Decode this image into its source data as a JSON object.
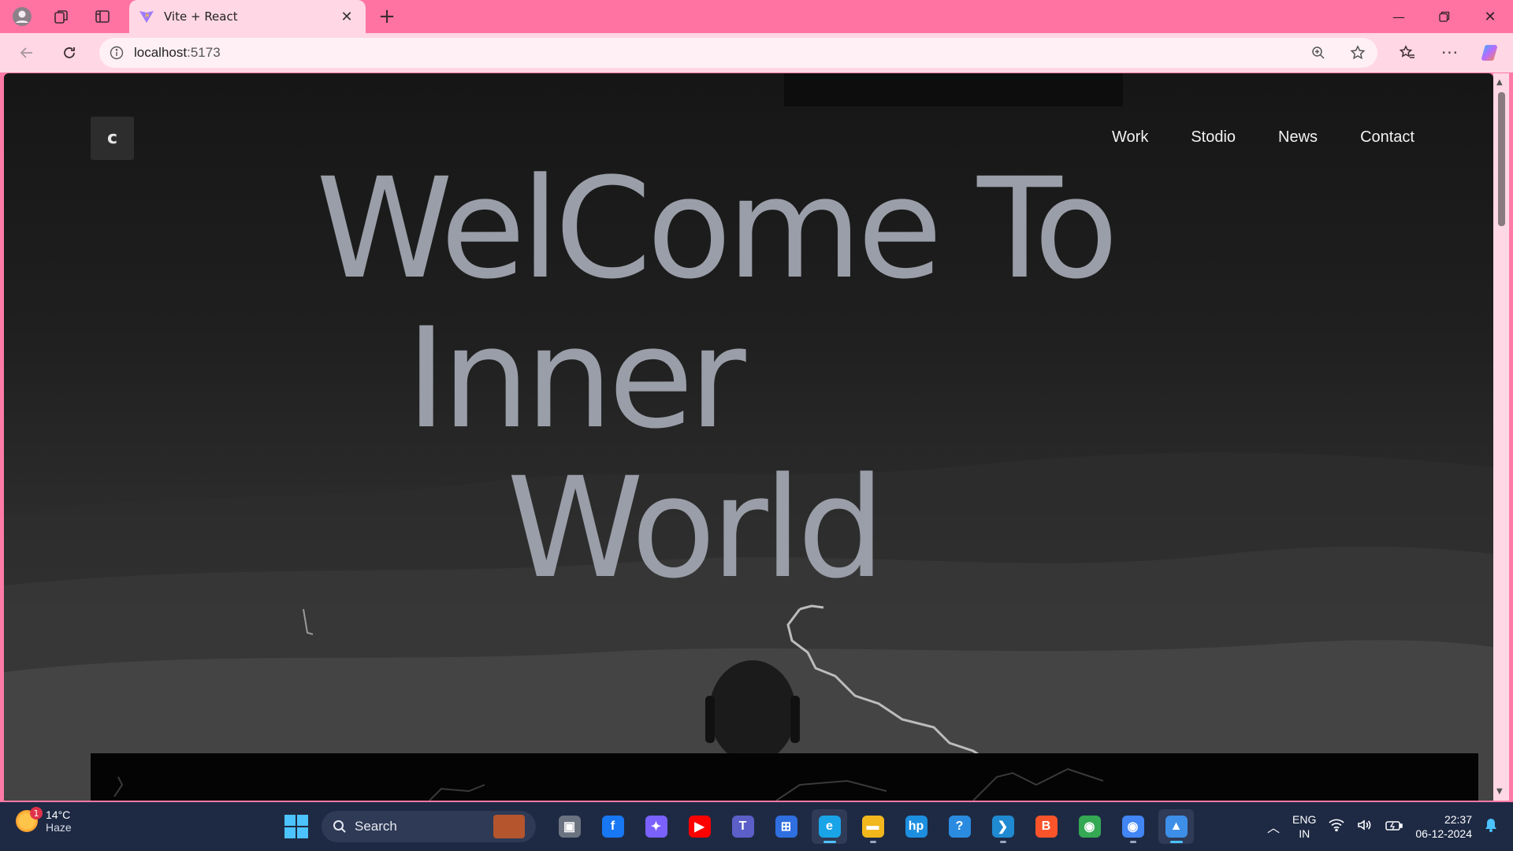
{
  "browser": {
    "tab": {
      "title": "Vite + React",
      "favicon": "vite-logo-icon"
    },
    "address": {
      "host": "localhost",
      "port": ":5173"
    }
  },
  "site": {
    "logo_letter": "c",
    "nav": [
      "Work",
      "Stodio",
      "News",
      "Contact"
    ],
    "hero": {
      "line1": "WelCome To",
      "line2": "Inner",
      "line3": "World"
    }
  },
  "taskbar": {
    "weather": {
      "temp": "14°C",
      "condition": "Haze",
      "badge": "1"
    },
    "search_label": "Search",
    "apps": [
      {
        "name": "task-view-app",
        "glyph": "▣",
        "color": "#6b7280"
      },
      {
        "name": "facebook-app",
        "glyph": "f",
        "color": "#1877f2"
      },
      {
        "name": "copilot-app",
        "glyph": "✦",
        "color": "#7b61ff"
      },
      {
        "name": "youtube-app",
        "glyph": "▶",
        "color": "#ff0000"
      },
      {
        "name": "teams-app",
        "glyph": "T",
        "color": "#5b5fc7"
      },
      {
        "name": "microsoft-store-app",
        "glyph": "⊞",
        "color": "#2f6fe0"
      },
      {
        "name": "edge-browser-app",
        "glyph": "e",
        "color": "#1aa4e8"
      },
      {
        "name": "file-explorer-app",
        "glyph": "▬",
        "color": "#f2b71d"
      },
      {
        "name": "myhp-app",
        "glyph": "hp",
        "color": "#1d8fe0"
      },
      {
        "name": "help-app",
        "glyph": "?",
        "color": "#2a8be0"
      },
      {
        "name": "vscode-app",
        "glyph": "❯",
        "color": "#1f8ad2"
      },
      {
        "name": "brave-browser-app",
        "glyph": "B",
        "color": "#fb542b"
      },
      {
        "name": "chrome-app",
        "glyph": "◉",
        "color": "#34a853"
      },
      {
        "name": "chrome-profile-app",
        "glyph": "◉",
        "color": "#4285f4"
      },
      {
        "name": "photos-app",
        "glyph": "▲",
        "color": "#3d8fe8"
      }
    ],
    "tray": {
      "lang_top": "ENG",
      "lang_bottom": "IN",
      "time": "22:37",
      "date": "06-12-2024"
    }
  }
}
